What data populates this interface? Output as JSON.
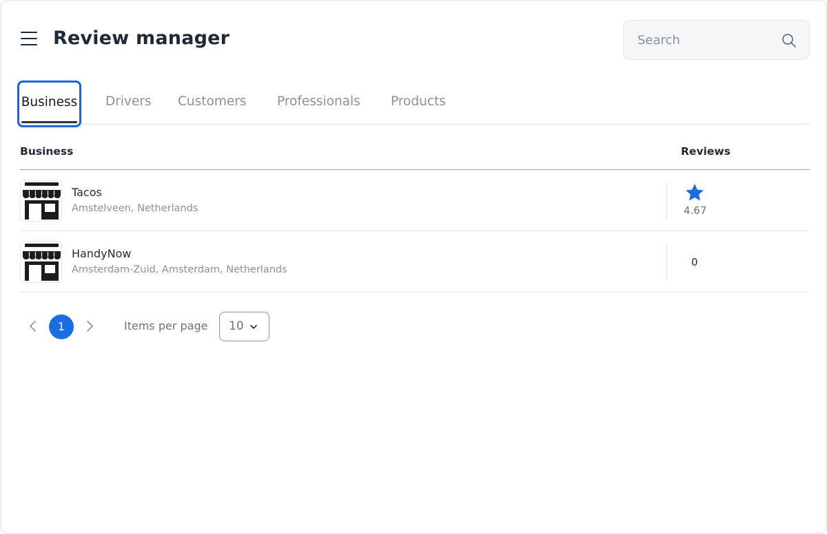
{
  "header": {
    "title": "Review manager",
    "search": {
      "placeholder": "Search",
      "value": ""
    }
  },
  "tabs": [
    {
      "label": "Business",
      "active": true
    },
    {
      "label": "Drivers",
      "active": false
    },
    {
      "label": "Customers",
      "active": false
    },
    {
      "label": "Professionals",
      "active": false
    },
    {
      "label": "Products",
      "active": false
    }
  ],
  "table": {
    "columns": [
      "Business",
      "Reviews"
    ],
    "rows": [
      {
        "name": "Tacos",
        "address": "Amstelveen, Netherlands",
        "rating": "4.67",
        "icon": "storefront-icon",
        "has_star": true
      },
      {
        "name": "HandyNow",
        "address": "Amsterdam-Zuid, Amsterdam, Netherlands",
        "rating": "0",
        "icon": "storefront-icon",
        "has_star": false
      }
    ]
  },
  "pagination": {
    "current_page": "1",
    "items_per_page_label": "Items per page",
    "items_per_page_value": "10"
  },
  "colors": {
    "accent": "#1a6fe0",
    "focus_outline": "#1a63d9",
    "star": "#1a6fe0"
  }
}
